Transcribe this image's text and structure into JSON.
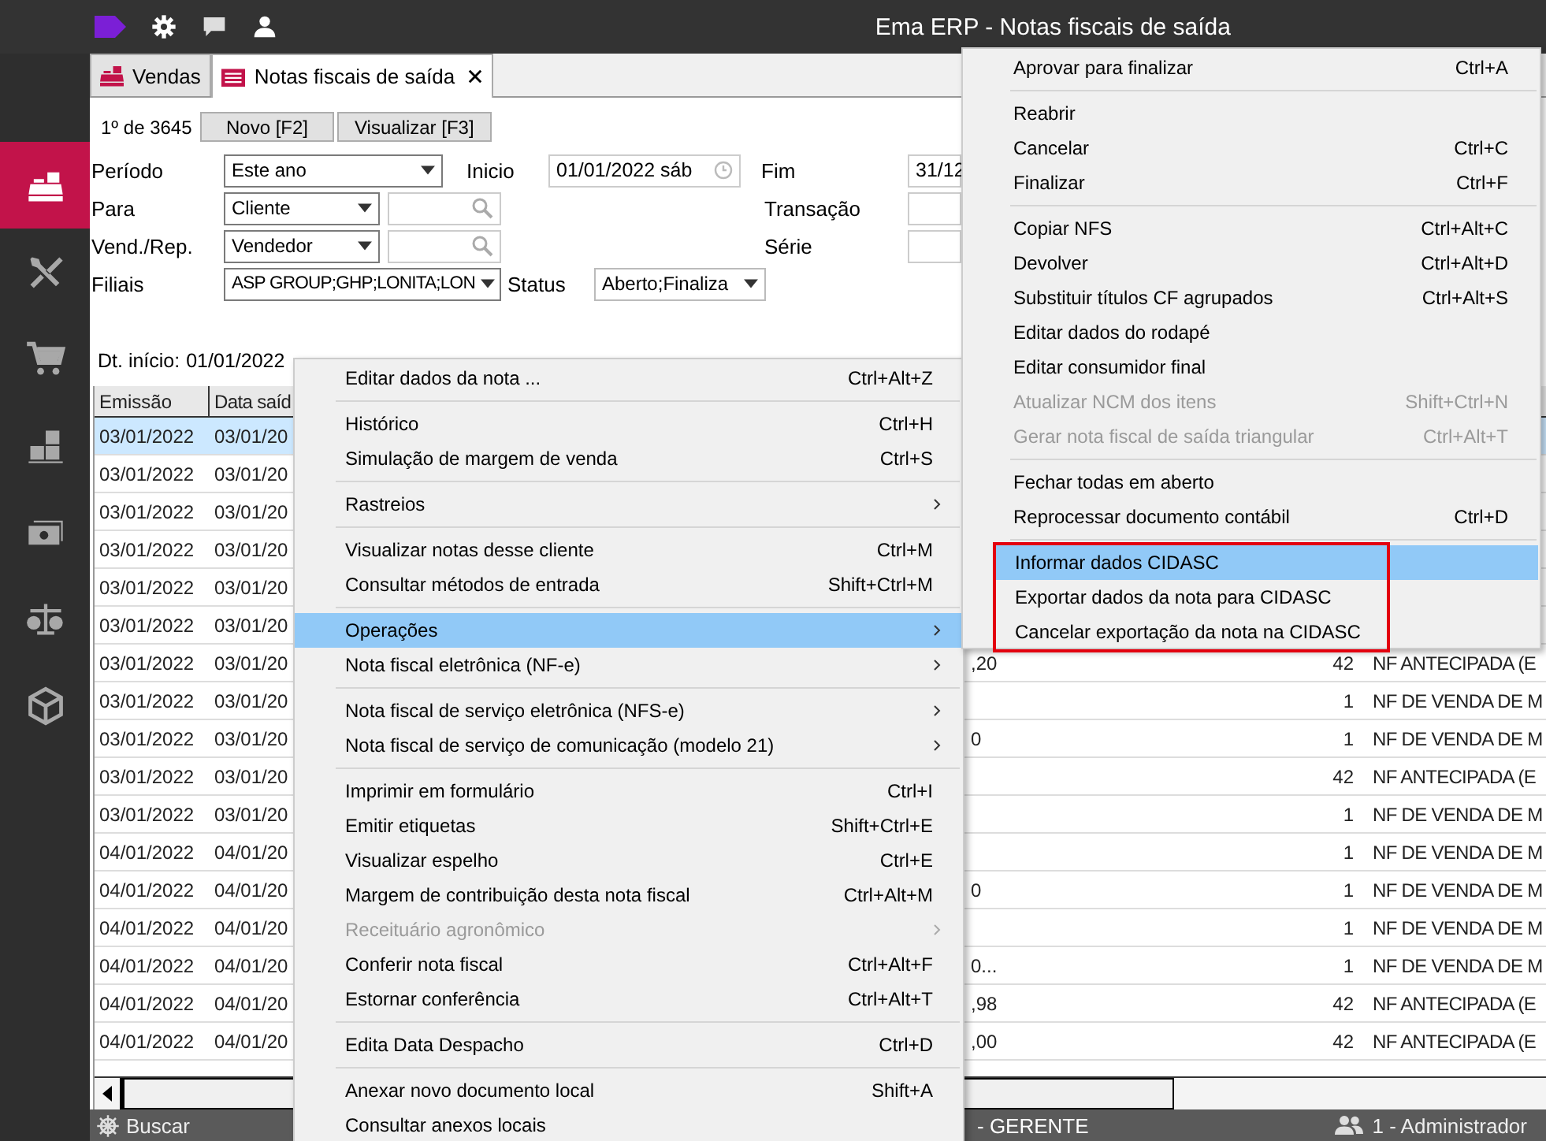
{
  "window": {
    "title": "Ema ERP - Notas fiscais de saída"
  },
  "sidebar": {
    "items": [
      {
        "kind": "register",
        "selected": true
      },
      {
        "kind": "tools",
        "selected": false
      },
      {
        "kind": "cart",
        "selected": false
      },
      {
        "kind": "boxes",
        "selected": false
      },
      {
        "kind": "money",
        "selected": false
      },
      {
        "kind": "scale",
        "selected": false
      },
      {
        "kind": "package",
        "selected": false
      }
    ]
  },
  "tabs": [
    {
      "label": "Vendas",
      "selected": false,
      "closable": false
    },
    {
      "label": "Notas fiscais de saída",
      "selected": true,
      "closable": true
    }
  ],
  "toolbar": {
    "record_counter": "1º de 3645",
    "buttons": [
      "Novo [F2]",
      "Visualizar [F3]"
    ]
  },
  "filters": {
    "period": {
      "label": "Período",
      "value": "Este ano"
    },
    "start": {
      "label": "Inicio",
      "value": "01/01/2022 sáb"
    },
    "end": {
      "label": "Fim",
      "value": "31/12"
    },
    "recipient": {
      "label": "Para",
      "value": "Cliente"
    },
    "transaction": {
      "label": "Transação"
    },
    "seller": {
      "label": "Vend./Rep.",
      "value": "Vendedor"
    },
    "series": {
      "label": "Série"
    },
    "branches": {
      "label": "Filiais",
      "value": "ASP GROUP;GHP;LONITA;LON"
    },
    "status": {
      "label": "Status",
      "value": "Aberto;Finaliza"
    }
  },
  "start_date": {
    "label": "Dt. início:",
    "value": "01/01/2022"
  },
  "table": {
    "columns": [
      "Emissão",
      "Data saíd"
    ],
    "rows": [
      {
        "column_1": "03/01/2022",
        "column_2": "03/01/20",
        "selected": true
      },
      {
        "column_1": "03/01/2022",
        "column_2": "03/01/20",
        "selected": false
      },
      {
        "column_1": "03/01/2022",
        "column_2": "03/01/20",
        "selected": false
      },
      {
        "column_1": "03/01/2022",
        "column_2": "03/01/20",
        "selected": false
      },
      {
        "column_1": "03/01/2022",
        "column_2": "03/01/20",
        "selected": false
      },
      {
        "column_1": "03/01/2022",
        "column_2": "03/01/20",
        "selected": false
      },
      {
        "column_1": "03/01/2022",
        "column_2": "03/01/20",
        "column_3": ",20",
        "column_4": "42",
        "column_5": "NF ANTECIPADA (E",
        "selected": false
      },
      {
        "column_1": "03/01/2022",
        "column_2": "03/01/20",
        "column_4": "1",
        "column_5": "NF DE VENDA DE M",
        "selected": false
      },
      {
        "column_1": "03/01/2022",
        "column_2": "03/01/20",
        "column_3": "0",
        "column_4": "1",
        "column_5": "NF DE VENDA DE M",
        "selected": false
      },
      {
        "column_1": "03/01/2022",
        "column_2": "03/01/20",
        "column_4": "42",
        "column_5": "NF ANTECIPADA (E",
        "selected": false
      },
      {
        "column_1": "03/01/2022",
        "column_2": "03/01/20",
        "column_4": "1",
        "column_5": "NF DE VENDA DE M",
        "selected": false
      },
      {
        "column_1": "04/01/2022",
        "column_2": "04/01/20",
        "column_4": "1",
        "column_5": "NF DE VENDA DE M",
        "selected": false
      },
      {
        "column_1": "04/01/2022",
        "column_2": "04/01/20",
        "column_3": "0",
        "column_4": "1",
        "column_5": "NF DE VENDA DE M",
        "selected": false
      },
      {
        "column_1": "04/01/2022",
        "column_2": "04/01/20",
        "column_4": "1",
        "column_5": "NF DE VENDA DE M",
        "selected": false
      },
      {
        "column_1": "04/01/2022",
        "column_2": "04/01/20",
        "column_3": "0...",
        "column_4": "1",
        "column_5": "NF DE VENDA DE M",
        "selected": false
      },
      {
        "column_1": "04/01/2022",
        "column_2": "04/01/20",
        "column_3": ",98",
        "column_4": "42",
        "column_5": "NF ANTECIPADA (E",
        "selected": false
      },
      {
        "column_1": "04/01/2022",
        "column_2": "04/01/20",
        "column_3": ",00",
        "column_4": "42",
        "column_5": "NF ANTECIPADA (E",
        "selected": false
      }
    ]
  },
  "status_bar": {
    "search": "Buscar",
    "role": "- GERENTE",
    "user": "1 - Administrador"
  },
  "context_menu": {
    "sections": [
      {
        "items": [
          {
            "label": "Editar dados da nota ...",
            "shortcut": "Ctrl+Alt+Z",
            "arrow": false,
            "disabled": false,
            "selected": false
          }
        ]
      },
      {
        "items": [
          {
            "label": "Histórico",
            "shortcut": "Ctrl+H",
            "arrow": false,
            "disabled": false,
            "selected": false
          },
          {
            "label": "Simulação de margem de venda",
            "shortcut": "Ctrl+S",
            "arrow": false,
            "disabled": false,
            "selected": false
          }
        ]
      },
      {
        "items": [
          {
            "label": "Rastreios",
            "arrow": true,
            "disabled": false,
            "selected": false
          }
        ]
      },
      {
        "items": [
          {
            "label": "Visualizar notas desse cliente",
            "shortcut": "Ctrl+M",
            "arrow": false,
            "disabled": false,
            "selected": false
          },
          {
            "label": "Consultar métodos de entrada",
            "shortcut": "Shift+Ctrl+M",
            "arrow": false,
            "disabled": false,
            "selected": false
          }
        ]
      },
      {
        "items": [
          {
            "label": "Operações",
            "arrow": true,
            "disabled": false,
            "selected": true
          },
          {
            "label": "Nota fiscal eletrônica (NF-e)",
            "arrow": true,
            "disabled": false,
            "selected": false
          }
        ]
      },
      {
        "items": [
          {
            "label": "Nota fiscal de serviço eletrônica (NFS-e)",
            "arrow": true,
            "disabled": false,
            "selected": false
          },
          {
            "label": "Nota fiscal de serviço de comunicação (modelo 21)",
            "arrow": true,
            "disabled": false,
            "selected": false
          }
        ]
      },
      {
        "items": [
          {
            "label": "Imprimir em formulário",
            "shortcut": "Ctrl+I",
            "arrow": false,
            "disabled": false,
            "selected": false
          },
          {
            "label": "Emitir etiquetas",
            "shortcut": "Shift+Ctrl+E",
            "arrow": false,
            "disabled": false,
            "selected": false
          },
          {
            "label": "Visualizar espelho",
            "shortcut": "Ctrl+E",
            "arrow": false,
            "disabled": false,
            "selected": false
          },
          {
            "label": "Margem de contribuição desta nota fiscal",
            "shortcut": "Ctrl+Alt+M",
            "arrow": false,
            "disabled": false,
            "selected": false
          },
          {
            "label": "Receituário agronômico",
            "arrow": true,
            "disabled": true,
            "selected": false
          },
          {
            "label": "Conferir nota fiscal",
            "shortcut": "Ctrl+Alt+F",
            "arrow": false,
            "disabled": false,
            "selected": false
          },
          {
            "label": "Estornar conferência",
            "shortcut": "Ctrl+Alt+T",
            "arrow": false,
            "disabled": false,
            "selected": false
          }
        ]
      },
      {
        "items": [
          {
            "label": "Edita Data Despacho",
            "shortcut": "Ctrl+D",
            "arrow": false,
            "disabled": false,
            "selected": false
          }
        ]
      },
      {
        "items": [
          {
            "label": "Anexar novo documento local",
            "shortcut": "Shift+A",
            "arrow": false,
            "disabled": false,
            "selected": false
          },
          {
            "label": "Consultar anexos locais",
            "arrow": false,
            "disabled": false,
            "selected": false
          }
        ]
      }
    ]
  },
  "submenu": {
    "sections": [
      {
        "outlined": false,
        "items": [
          {
            "label": "Aprovar para finalizar",
            "shortcut": "Ctrl+A",
            "disabled": false,
            "selected": false
          }
        ]
      },
      {
        "outlined": false,
        "items": [
          {
            "label": "Reabrir",
            "disabled": false,
            "selected": false
          },
          {
            "label": "Cancelar",
            "shortcut": "Ctrl+C",
            "disabled": false,
            "selected": false
          },
          {
            "label": "Finalizar",
            "shortcut": "Ctrl+F",
            "disabled": false,
            "selected": false
          }
        ]
      },
      {
        "outlined": false,
        "items": [
          {
            "label": "Copiar NFS",
            "shortcut": "Ctrl+Alt+C",
            "disabled": false,
            "selected": false
          },
          {
            "label": "Devolver",
            "shortcut": "Ctrl+Alt+D",
            "disabled": false,
            "selected": false
          },
          {
            "label": "Substituir títulos CF agrupados",
            "shortcut": "Ctrl+Alt+S",
            "disabled": false,
            "selected": false
          },
          {
            "label": "Editar dados do rodapé",
            "disabled": false,
            "selected": false
          },
          {
            "label": "Editar consumidor final",
            "disabled": false,
            "selected": false
          },
          {
            "label": "Atualizar NCM dos itens",
            "shortcut": "Shift+Ctrl+N",
            "disabled": true,
            "selected": false
          },
          {
            "label": "Gerar nota fiscal de saída triangular",
            "shortcut": "Ctrl+Alt+T",
            "disabled": true,
            "selected": false
          }
        ]
      },
      {
        "outlined": false,
        "items": [
          {
            "label": "Fechar todas em aberto",
            "disabled": false,
            "selected": false
          },
          {
            "label": "Reprocessar documento contábil",
            "shortcut": "Ctrl+D",
            "disabled": false,
            "selected": false
          }
        ]
      },
      {
        "outlined": true,
        "items": [
          {
            "label": "Informar dados CIDASC",
            "disabled": false,
            "selected": true
          },
          {
            "label": "Exportar dados da nota para CIDASC",
            "disabled": false,
            "selected": false
          },
          {
            "label": "Cancelar exportação da nota na CIDASC",
            "disabled": false,
            "selected": false
          }
        ]
      }
    ]
  }
}
